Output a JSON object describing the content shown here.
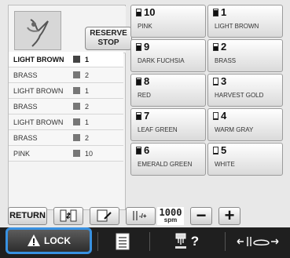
{
  "left_panel": {
    "reserve_stop_label": "RESERVE\nSTOP",
    "color_rows": [
      {
        "name": "LIGHT BROWN",
        "num": "1",
        "selected": true
      },
      {
        "name": "BRASS",
        "num": "2",
        "selected": false
      },
      {
        "name": "LIGHT BROWN",
        "num": "1",
        "selected": false
      },
      {
        "name": "BRASS",
        "num": "2",
        "selected": false
      },
      {
        "name": "LIGHT BROWN",
        "num": "1",
        "selected": false
      },
      {
        "name": "BRASS",
        "num": "2",
        "selected": false
      },
      {
        "name": "PINK",
        "num": "10",
        "selected": false
      }
    ]
  },
  "threads": [
    {
      "num": "10",
      "name": "PINK",
      "fill": 0.6
    },
    {
      "num": "1",
      "name": "LIGHT BROWN",
      "fill": 0.9
    },
    {
      "num": "9",
      "name": "DARK FUCHSIA",
      "fill": 0.7
    },
    {
      "num": "2",
      "name": "BRASS",
      "fill": 0.6
    },
    {
      "num": "8",
      "name": "RED",
      "fill": 0.9
    },
    {
      "num": "3",
      "name": "HARVEST GOLD",
      "fill": 0.1
    },
    {
      "num": "7",
      "name": "LEAF GREEN",
      "fill": 0.8
    },
    {
      "num": "4",
      "name": "WARM GRAY",
      "fill": 0.1
    },
    {
      "num": "6",
      "name": "EMERALD GREEN",
      "fill": 0.9
    },
    {
      "num": "5",
      "name": "WHITE",
      "fill": 0.1
    }
  ],
  "toolbar": {
    "return_label": "RETURN",
    "speed_value": "1000",
    "speed_unit": "spm",
    "minus_label": "−",
    "plus_label": "+"
  },
  "bottom_bar": {
    "lock_label": "LOCK",
    "help_label": "?"
  },
  "icons": {
    "lock": "warning-triangle-icon",
    "checklist": "checklist-icon",
    "needle": "needle-icon",
    "presser": "presser-foot-icon"
  }
}
